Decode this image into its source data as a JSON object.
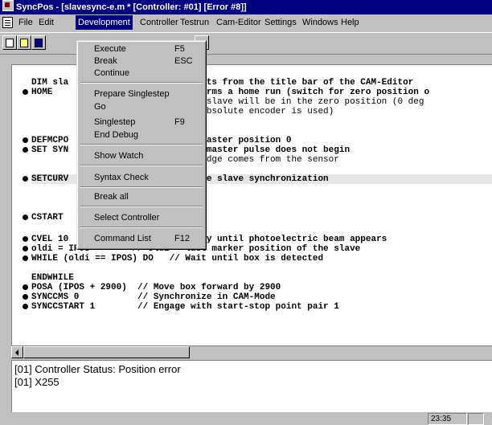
{
  "window": {
    "title": "SyncPos - [slavesync-e.m * [Controller: #01]  [Error #8]]"
  },
  "menubar": {
    "items": [
      "File",
      "Edit",
      "Development",
      "Controller",
      "Testrun",
      "Cam-Editor",
      "Settings",
      "Windows",
      "Help"
    ],
    "active": "Development"
  },
  "toolbar": {
    "icons": [
      "new-file-icon",
      "open-file-icon",
      "save-file-icon"
    ]
  },
  "dropdown": {
    "items": [
      {
        "label": "Execute",
        "shortcut": "F5"
      },
      {
        "label": "Break",
        "shortcut": "ESC"
      },
      {
        "label": "Continue",
        "shortcut": ""
      },
      {
        "label": "Prepare Singlestep",
        "shortcut": ""
      },
      {
        "label": "Go",
        "shortcut": ""
      },
      {
        "label": "Singlestep",
        "shortcut": "F9"
      },
      {
        "label": "End Debug",
        "shortcut": ""
      },
      {
        "label": "Show Watch",
        "shortcut": ""
      },
      {
        "label": "Syntax Check",
        "shortcut": ""
      },
      {
        "label": "Break all",
        "shortcut": ""
      },
      {
        "label": "Select Controller",
        "shortcut": ""
      },
      {
        "label": "Command List",
        "shortcut": "F12"
      }
    ]
  },
  "editor": {
    "lines": [
      "DIM sla                 of elements from the title bar of the CAM-Editor",
      "HOME                    xis performs a home run (switch for zero position o",
      "                        rds, the slave will be in the zero position (0 deg",
      "                        d if an absolute encoder is used)",
      "DEFMCPO                 arts at master position 0",
      "SET SYN                 g of the master pulse does not begin",
      "                        he next edge comes from the sensor",
      "SETCURV                 ve for the slave synchronization",
      "                        tart",
      "CSTART",
      "CVEL 10                 ard slowly until photoelectric beam appears",
      "oldi = IPOS        // oldi = last marker position of the slave",
      "WHILE (oldi == IPOS) DO   // Wait until box is detected",
      "ENDWHILE",
      "POSA (IPOS + 2900)  // Move box forward by 2900",
      "SYNCCMS 0           // Synchronize in CAM-Mode",
      "SYNCCSTART 1        // Engage with start-stop point pair 1"
    ]
  },
  "output": {
    "lines": [
      "[01] Controller Status: Position error",
      "[01] X255"
    ]
  },
  "statusbar": {
    "time": "23:35"
  }
}
